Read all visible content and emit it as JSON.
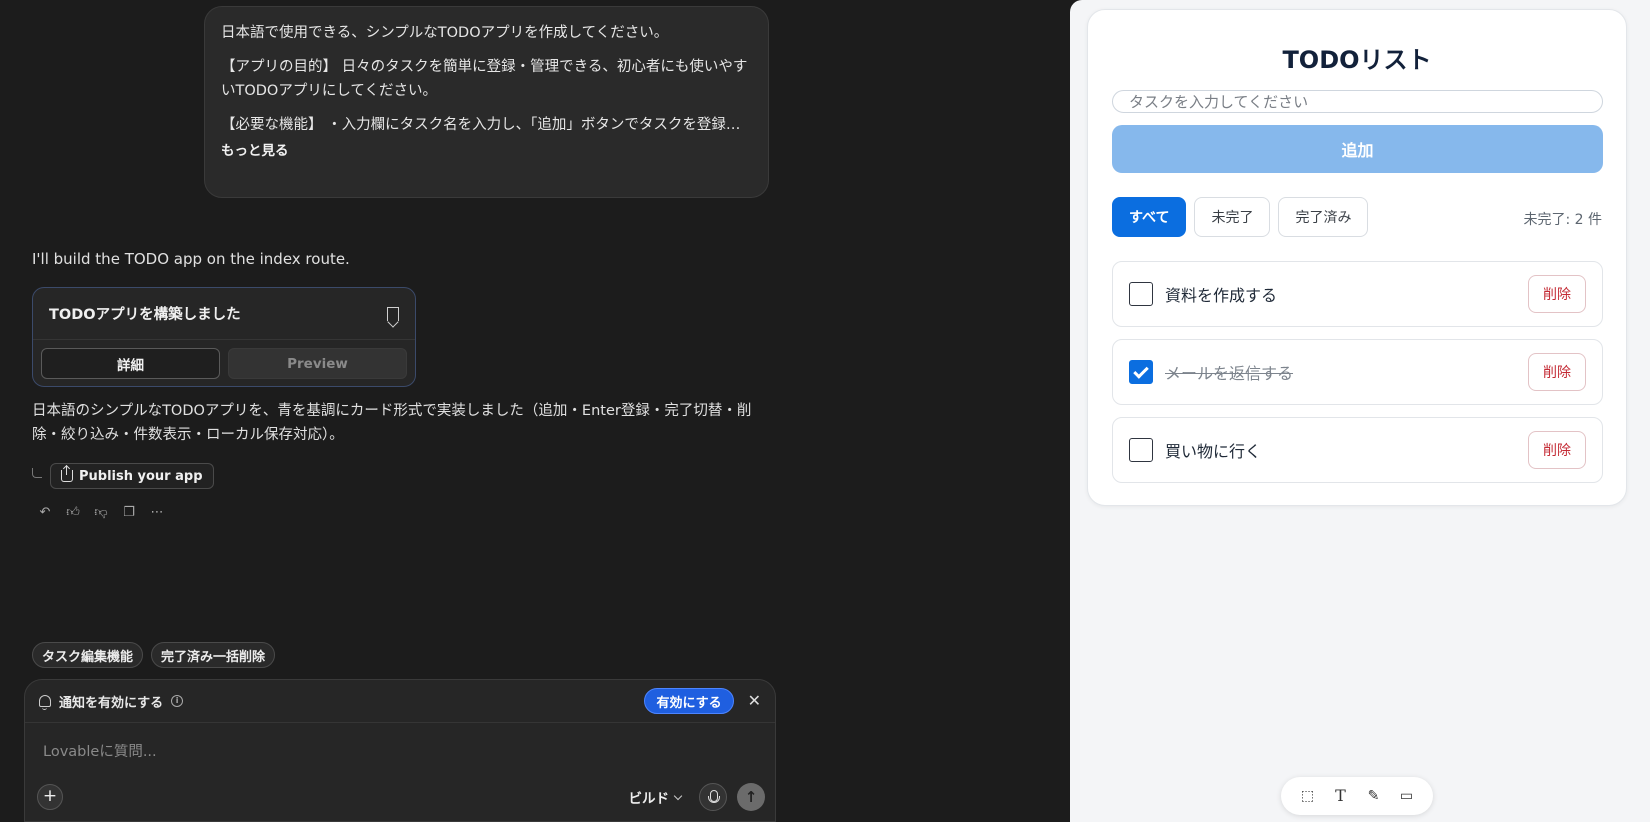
{
  "chat": {
    "user_message": {
      "line1": "日本語で使用できる、シンプルなTODOアプリを作成してください。",
      "line2": "【アプリの目的】 日々のタスクを簡単に登録・管理できる、初心者にも使いやすいTODOアプリにしてください。",
      "line3": "【必要な機能】 ・入力欄にタスク名を入力し、「追加」ボタンでタスクを登録できる ・...",
      "more_label": "もっと見る"
    },
    "assistant_intro": "I'll build the TODO app on the index route.",
    "artifact": {
      "title": "TODOアプリを構築しました",
      "details_label": "詳細",
      "preview_label": "Preview"
    },
    "summary": "日本語のシンプルなTODOアプリを、青を基調にカード形式で実装しました（追加・Enter登録・完了切替・削除・絞り込み・件数表示・ローカル保存対応）。",
    "publish_label": "Publish your app",
    "suggestions": [
      "タスク編集機能",
      "完了済み一括削除"
    ],
    "notification": {
      "text": "通知を有効にする",
      "enable_label": "有効にする"
    },
    "composer": {
      "placeholder": "Lovableに質問...",
      "mode_label": "ビルド"
    }
  },
  "todo": {
    "title": "TODOリスト",
    "input_placeholder": "タスクを入力してください",
    "add_label": "追加",
    "filters": [
      {
        "label": "すべて",
        "active": true
      },
      {
        "label": "未完了",
        "active": false
      },
      {
        "label": "完了済み",
        "active": false
      }
    ],
    "remaining_text": "未完了: 2 件",
    "tasks": [
      {
        "label": "資料を作成する",
        "done": false,
        "delete_label": "削除"
      },
      {
        "label": "メールを返信する",
        "done": true,
        "delete_label": "削除"
      },
      {
        "label": "買い物に行く",
        "done": false,
        "delete_label": "削除"
      }
    ]
  },
  "colors": {
    "accent": "#0b6ee0",
    "add_button": "#86b8ec",
    "delete_text": "#c42b35",
    "enable_button": "#1f5fe0"
  }
}
